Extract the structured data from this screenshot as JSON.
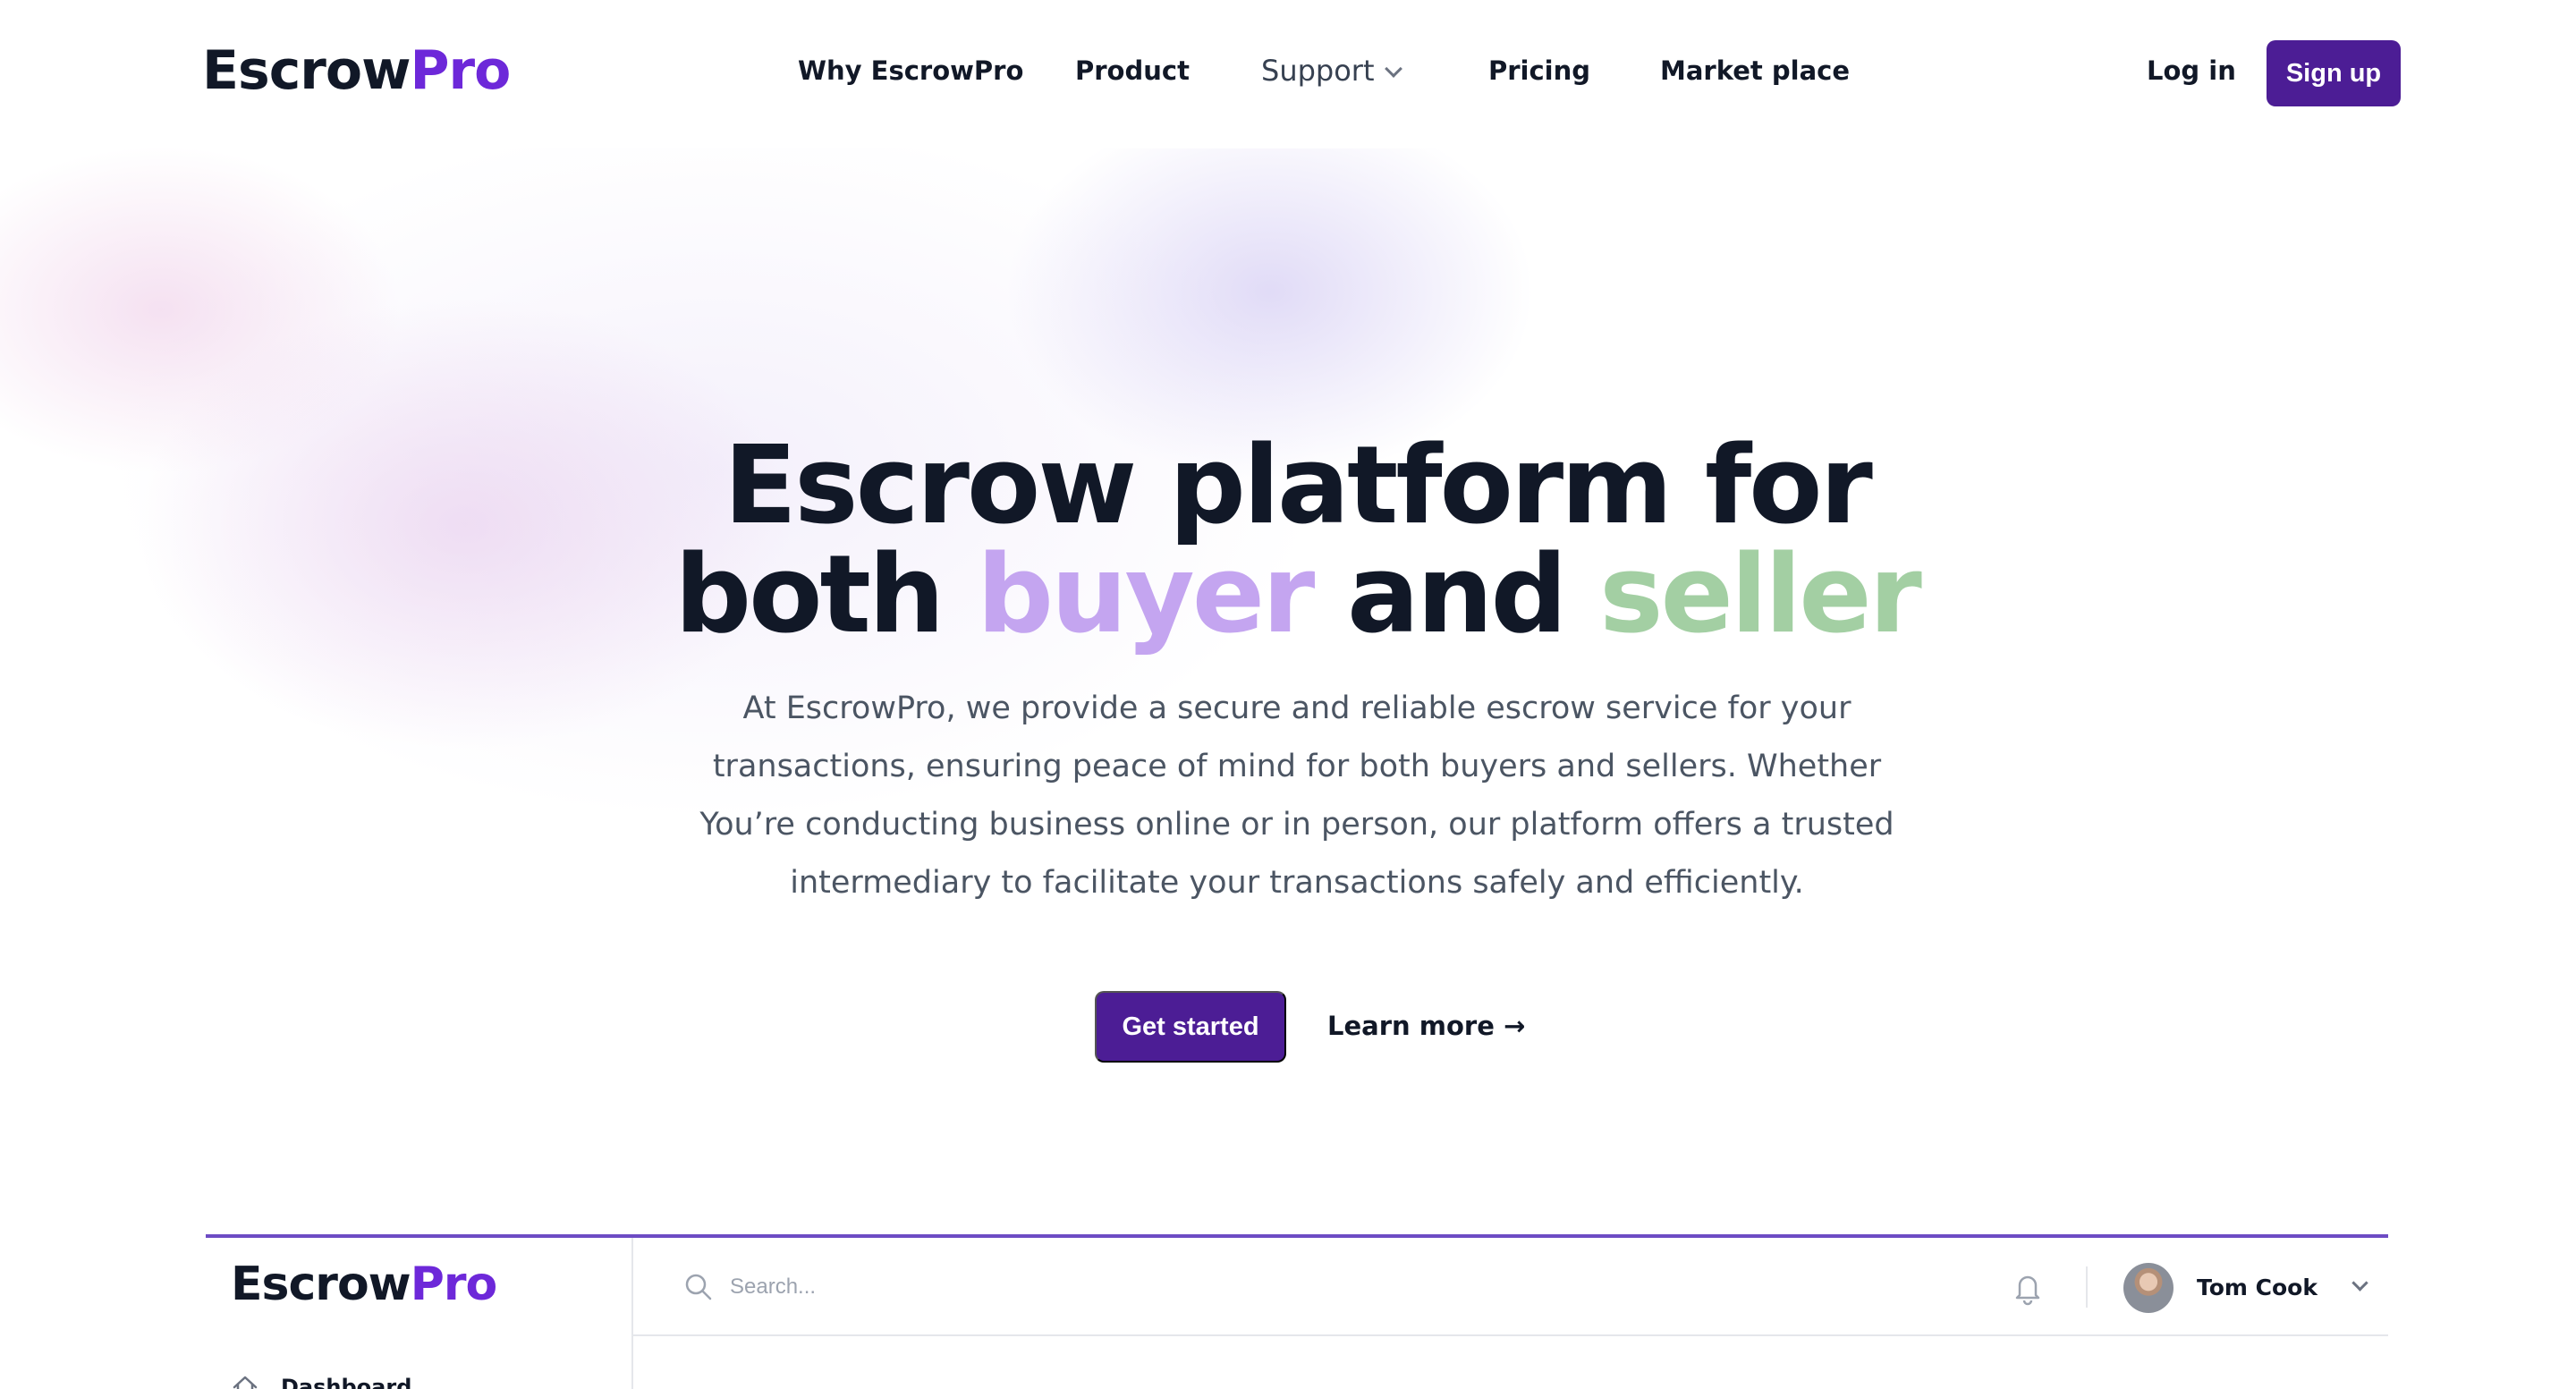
{
  "nav": {
    "logo_main": "Escrow",
    "logo_accent": "Pro",
    "links": [
      {
        "label": "Why EscrowPro"
      },
      {
        "label": "Product"
      },
      {
        "label": "Support"
      },
      {
        "label": "Pricing"
      },
      {
        "label": "Market place"
      }
    ],
    "login_label": "Log in",
    "signup_label": "Sign up"
  },
  "hero": {
    "title_line1": "Escrow platform for",
    "title_line2_pre": "both ",
    "title_buyer": "buyer",
    "title_and": " and ",
    "title_seller": "seller",
    "description": "At EscrowPro, we provide a secure and reliable escrow service for your transactions, ensuring peace of mind for both buyers and sellers. Whether You’re conducting business online or in person, our platform offers a trusted intermediary to facilitate your transactions safely and efficiently.",
    "primary_cta": "Get started",
    "secondary_cta": "Learn more →"
  },
  "app_preview": {
    "logo_main": "Escrow",
    "logo_accent": "Pro",
    "sidebar_items": [
      {
        "label": "Dashboard",
        "icon": "home-icon"
      }
    ],
    "search_placeholder": "Search...",
    "user_name": "Tom Cook"
  },
  "colors": {
    "brand_primary": "#4c1d95",
    "logo_accent": "#6d28d9",
    "buyer": "#c4a5f0",
    "seller": "#a3cfa3"
  }
}
